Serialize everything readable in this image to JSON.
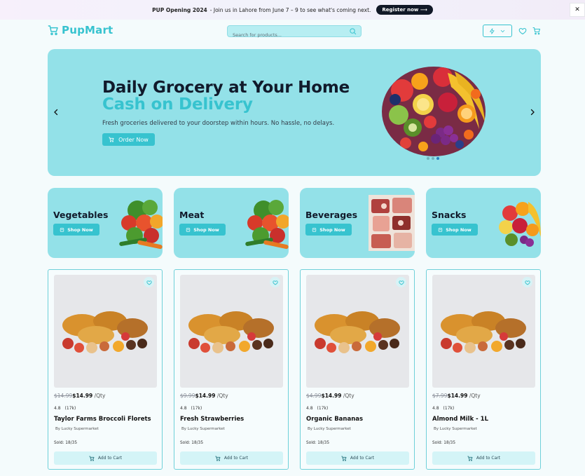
{
  "announcement": {
    "title": "PUP Opening 2024",
    "message": " -  Join us in Lahore from June 7 – 9 to see what's coming next.",
    "button": "Register now ⟶",
    "close": "✕"
  },
  "header": {
    "brand": "PupMart",
    "search_placeholder": "Search for products..."
  },
  "hero": {
    "headline": "Daily Grocery at Your Home",
    "subheadline": "Cash on Delivery",
    "description": "Fresh groceries delivered to your doorstep within hours. No hassle, no delays.",
    "button": "Order Now",
    "slides": 3,
    "active_slide": 3
  },
  "categories": [
    {
      "name": "Vegetables",
      "button": "Shop Now",
      "art": "vegetables"
    },
    {
      "name": "Meat",
      "button": "Shop Now",
      "art": "vegetables"
    },
    {
      "name": "Beverages",
      "button": "Shop Now",
      "art": "meat"
    },
    {
      "name": "Snacks",
      "button": "Shop Now",
      "art": "fruit"
    }
  ],
  "products": [
    {
      "old_price": "$14.99",
      "price": "$14.99",
      "unit": " /Qty",
      "rating": "4.8",
      "reviews": "(17k)",
      "title": "Taylor Farms Broccoli Florets",
      "seller": "By Lucky Supermarket",
      "sold": "Sold: 18/35",
      "button": "Add to Cart"
    },
    {
      "old_price": "$9.99",
      "price": "$14.99",
      "unit": " /Qty",
      "rating": "4.8",
      "reviews": "(17k)",
      "title": "Fresh Strawberries",
      "seller": "By Lucky Supermarket",
      "sold": "Sold: 18/35",
      "button": "Add to Cart"
    },
    {
      "old_price": "$4.99",
      "price": "$14.99",
      "unit": " /Qty",
      "rating": "4.8",
      "reviews": "(17k)",
      "title": "Organic Bananas",
      "seller": "By Lucky Supermarket",
      "sold": "Sold: 18/35",
      "button": "Add to Cart"
    },
    {
      "old_price": "$7.99",
      "price": "$14.99",
      "unit": " /Qty",
      "rating": "4.8",
      "reviews": "(17k)",
      "title": "Almond Milk - 1L",
      "seller": "By Lucky Supermarket",
      "sold": "Sold: 18/35",
      "button": "Add to Cart"
    }
  ],
  "colors": {
    "accent": "#37c3cf",
    "hero_bg": "#93e1e8",
    "text_dark": "#111a2b"
  }
}
